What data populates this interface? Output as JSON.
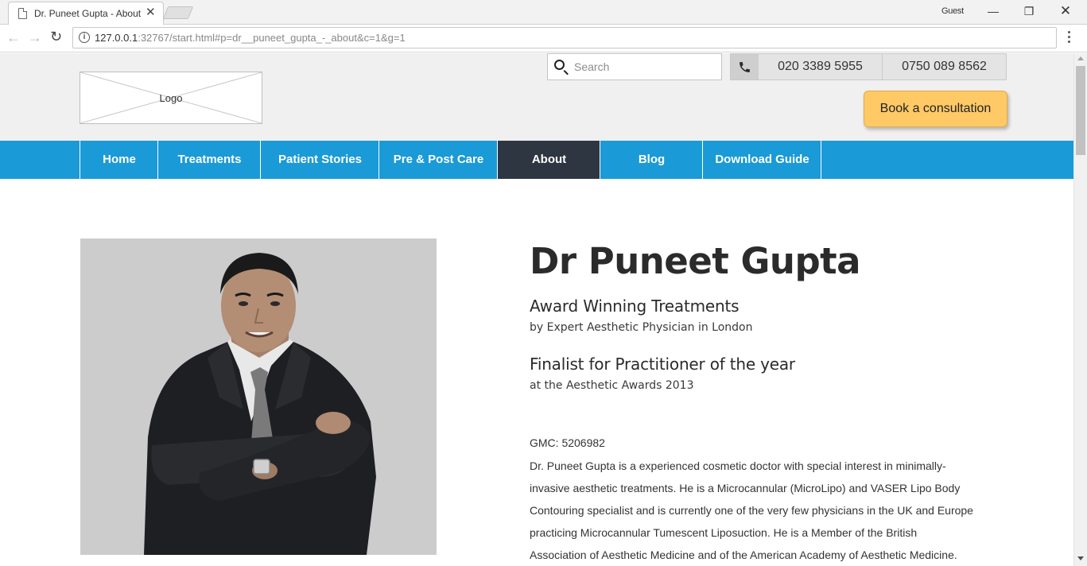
{
  "browser": {
    "tab_title": "Dr. Puneet Gupta - About",
    "profile": "Guest",
    "url_host": "127.0.0.1",
    "url_rest": ":32767/start.html#p=dr__puneet_gupta_-_about&c=1&g=1"
  },
  "header": {
    "logo_label": "Logo",
    "search_placeholder": "Search",
    "phone_1": "020 3389 5955",
    "phone_2": "0750 089 8562",
    "cta_label": "Book a consultation"
  },
  "nav": {
    "items": [
      {
        "label": "Home"
      },
      {
        "label": "Treatments"
      },
      {
        "label": "Patient Stories"
      },
      {
        "label": "Pre & Post Care"
      },
      {
        "label": "About"
      },
      {
        "label": "Blog"
      },
      {
        "label": "Download Guide"
      }
    ],
    "active_index": 4
  },
  "profile": {
    "name": "Dr Puneet Gupta",
    "headline_1": "Award Winning Treatments",
    "subline_1": "by Expert Aesthetic Physician in London",
    "headline_2": "Finalist for Practitioner of the year",
    "subline_2": "at the Aesthetic Awards 2013",
    "gmc": "GMC: 5206982",
    "bio": "Dr. Puneet Gupta is a experienced cosmetic doctor with special interest in minimally-invasive aesthetic treatments. He is a Microcannular (MicroLipo) and VASER Lipo Body Contouring specialist and is currently one of the very few physicians in the UK and Europe practicing Microcannular Tumescent Liposuction. He is a Member of the British Association of Aesthetic Medicine and of the American Academy of Aesthetic Medicine."
  },
  "colors": {
    "nav_bg": "#1a9ad6",
    "nav_active": "#2e3642",
    "cta_bg": "#ffc966",
    "header_bg": "#f0f0f0"
  }
}
